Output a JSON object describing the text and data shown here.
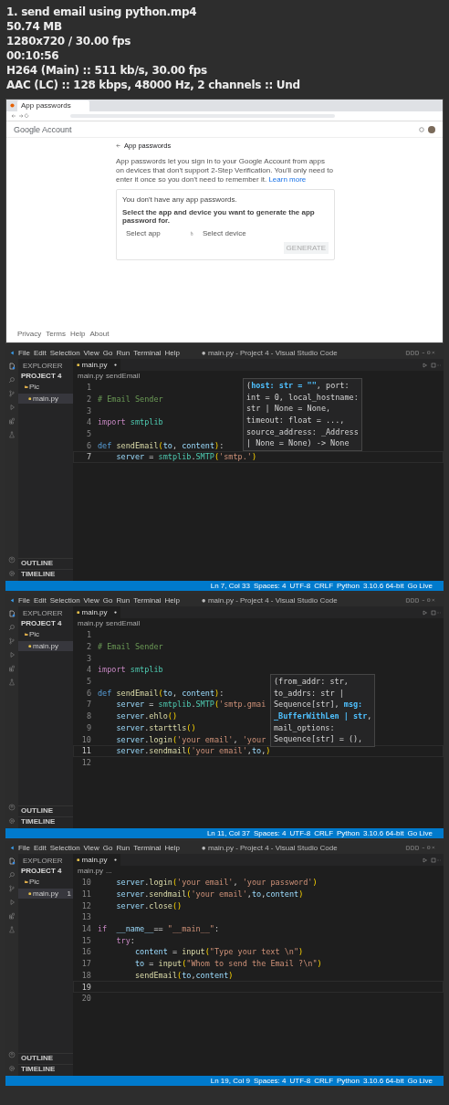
{
  "info_lines": [
    "1. send email using python.mp4",
    "50.74 MB",
    "1280x720 / 30.00 fps",
    "00:10:56",
    "H264 (Main) :: 511 kb/s, 30.00 fps",
    "AAC (LC) :: 128 kbps, 48000 Hz, 2 channels :: Und"
  ],
  "frames": [
    {
      "kind": "browser",
      "tab": "App passwords",
      "brand": "Google Account",
      "heading": "App passwords",
      "intro": "App passwords let you sign in to your Google Account from apps on devices that don't support 2-Step Verification. You'll only need to enter it once so you don't need to remember it.",
      "learn_more": "Learn more",
      "empty_note": "You don't have any app passwords.",
      "instruction": "Select the app and device you want to generate the app password for.",
      "select_app": "Select app",
      "select_device": "Select device",
      "generate": "GENERATE",
      "footer_links": [
        "Privacy",
        "Terms",
        "Help",
        "About"
      ]
    },
    {
      "kind": "editor",
      "menu": [
        "File",
        "Edit",
        "Selection",
        "View",
        "Go",
        "Run",
        "Terminal",
        "Help"
      ],
      "title": "● main.py - Project 4 - Visual Studio Code",
      "explorer": "EXPLORER",
      "project": "PROJECT 4",
      "tree": [
        {
          "label": "Pic",
          "kind": "folder",
          "selected": false
        },
        {
          "label": "main.py",
          "kind": "file",
          "selected": true
        }
      ],
      "tab": "main.py",
      "modified": true,
      "breadcrumb": [
        "main.py",
        "sendEmail"
      ],
      "lines": [
        {
          "number": "1",
          "current": false
        },
        {
          "number": "2",
          "current": false,
          "tokens": [
            {
              "text": "# Email Sender",
              "kind": "cm"
            }
          ]
        },
        {
          "number": "3",
          "current": false
        },
        {
          "number": "4",
          "current": false,
          "tokens": [
            {
              "text": "import",
              "kind": "kw"
            },
            {
              "text": " smtplib",
              "kind": "mod"
            }
          ]
        },
        {
          "number": "5",
          "current": false
        },
        {
          "number": "6",
          "current": false,
          "tokens": [
            {
              "text": "def",
              "kind": "def"
            },
            {
              "text": " sendEmail",
              "kind": "fn"
            },
            {
              "text": "(",
              "kind": "br"
            },
            {
              "text": "to",
              "kind": "var"
            },
            {
              "text": ", ",
              "kind": "p"
            },
            {
              "text": "content",
              "kind": "var"
            },
            {
              "text": ")",
              "kind": "br"
            },
            {
              "text": ":",
              "kind": "p"
            }
          ]
        },
        {
          "number": "7",
          "current": true,
          "tokens": [
            {
              "text": "    server",
              "kind": "var"
            },
            {
              "text": " = ",
              "kind": "p"
            },
            {
              "text": "smtplib",
              "kind": "mod"
            },
            {
              "text": ".",
              "kind": "p"
            },
            {
              "text": "SMTP",
              "kind": "mod"
            },
            {
              "text": "(",
              "kind": "br"
            },
            {
              "text": "'smtp.'",
              "kind": "str"
            },
            {
              "text": ")",
              "kind": "br"
            }
          ]
        }
      ],
      "popup": {
        "lines": [
          [
            {
              "text": "(",
              "kind": "p"
            },
            {
              "text": "host: str = \"\"",
              "kind": "hl"
            },
            {
              "text": ", port:",
              "kind": "p"
            }
          ],
          [
            {
              "text": "int = 0, local_hostname:",
              "kind": "p"
            }
          ],
          [
            {
              "text": "str | None = None,",
              "kind": "p"
            }
          ],
          [
            {
              "text": "timeout: float = ...,",
              "kind": "p"
            }
          ],
          [
            {
              "text": "source_address: _Address",
              "kind": "p"
            }
          ],
          [
            {
              "text": "| None = None) -> None",
              "kind": "p"
            }
          ]
        ]
      },
      "panels": [
        "OUTLINE",
        "TIMELINE"
      ],
      "status": [
        "Ln 7, Col 33",
        "Spaces: 4",
        "UTF-8",
        "CRLF",
        "Python",
        "3.10.6 64-bit",
        "Go Live"
      ]
    },
    {
      "kind": "editor",
      "menu": [
        "File",
        "Edit",
        "Selection",
        "View",
        "Go",
        "Run",
        "Terminal",
        "Help"
      ],
      "title": "● main.py - Project 4 - Visual Studio Code",
      "explorer": "EXPLORER",
      "project": "PROJECT 4",
      "tree": [
        {
          "label": "Pic",
          "kind": "folder",
          "selected": false
        },
        {
          "label": "main.py",
          "kind": "file",
          "selected": true
        }
      ],
      "tab": "main.py",
      "modified": true,
      "breadcrumb": [
        "main.py",
        "sendEmail"
      ],
      "lines": [
        {
          "number": "1",
          "current": false
        },
        {
          "number": "2",
          "current": false,
          "tokens": [
            {
              "text": "# Email Sender",
              "kind": "cm"
            }
          ]
        },
        {
          "number": "3",
          "current": false
        },
        {
          "number": "4",
          "current": false,
          "tokens": [
            {
              "text": "import",
              "kind": "kw"
            },
            {
              "text": " smtplib",
              "kind": "mod"
            }
          ]
        },
        {
          "number": "5",
          "current": false
        },
        {
          "number": "6",
          "current": false,
          "tokens": [
            {
              "text": "def",
              "kind": "def"
            },
            {
              "text": " sendEmail",
              "kind": "fn"
            },
            {
              "text": "(",
              "kind": "br"
            },
            {
              "text": "to",
              "kind": "var"
            },
            {
              "text": ", ",
              "kind": "p"
            },
            {
              "text": "content",
              "kind": "var"
            },
            {
              "text": ")",
              "kind": "br"
            },
            {
              "text": ":",
              "kind": "p"
            }
          ]
        },
        {
          "number": "7",
          "current": false,
          "tokens": [
            {
              "text": "    server",
              "kind": "var"
            },
            {
              "text": " = ",
              "kind": "p"
            },
            {
              "text": "smtplib",
              "kind": "mod"
            },
            {
              "text": ".",
              "kind": "p"
            },
            {
              "text": "SMTP",
              "kind": "mod"
            },
            {
              "text": "(",
              "kind": "br"
            },
            {
              "text": "'smtp.gmai",
              "kind": "str"
            }
          ]
        },
        {
          "number": "8",
          "current": false,
          "tokens": [
            {
              "text": "    server",
              "kind": "var"
            },
            {
              "text": ".",
              "kind": "p"
            },
            {
              "text": "ehlo",
              "kind": "fn"
            },
            {
              "text": "()",
              "kind": "br"
            }
          ]
        },
        {
          "number": "9",
          "current": false,
          "tokens": [
            {
              "text": "    server",
              "kind": "var"
            },
            {
              "text": ".",
              "kind": "p"
            },
            {
              "text": "starttls",
              "kind": "fn"
            },
            {
              "text": "()",
              "kind": "br"
            }
          ]
        },
        {
          "number": "10",
          "current": false,
          "tokens": [
            {
              "text": "    server",
              "kind": "var"
            },
            {
              "text": ".",
              "kind": "p"
            },
            {
              "text": "login",
              "kind": "fn"
            },
            {
              "text": "(",
              "kind": "br"
            },
            {
              "text": "'your email'",
              "kind": "str"
            },
            {
              "text": ", ",
              "kind": "p"
            },
            {
              "text": "'your",
              "kind": "str"
            }
          ]
        },
        {
          "number": "11",
          "current": true,
          "tokens": [
            {
              "text": "    server",
              "kind": "var"
            },
            {
              "text": ".",
              "kind": "p"
            },
            {
              "text": "sendmail",
              "kind": "fn"
            },
            {
              "text": "(",
              "kind": "br"
            },
            {
              "text": "'your email'",
              "kind": "str"
            },
            {
              "text": ",",
              "kind": "p"
            },
            {
              "text": "to",
              "kind": "var"
            },
            {
              "text": ",",
              "kind": "p"
            },
            {
              "text": ")",
              "kind": "br"
            }
          ]
        },
        {
          "number": "12",
          "current": false
        }
      ],
      "popup": {
        "lines": [
          [
            {
              "text": "(from_addr: str,",
              "kind": "p"
            }
          ],
          [
            {
              "text": "to_addrs: str |",
              "kind": "p"
            }
          ],
          [
            {
              "text": "Sequence[str], ",
              "kind": "p"
            },
            {
              "text": "msg:",
              "kind": "hl"
            }
          ],
          [
            {
              "text": "_BufferWithLen | str",
              "kind": "hl"
            },
            {
              "text": ",",
              "kind": "p"
            }
          ],
          [
            {
              "text": "mail_options:",
              "kind": "p"
            }
          ],
          [
            {
              "text": "Sequence[str] = (),",
              "kind": "p"
            }
          ]
        ]
      },
      "panels": [
        "OUTLINE",
        "TIMELINE"
      ],
      "status": [
        "Ln 11, Col 37",
        "Spaces: 4",
        "UTF-8",
        "CRLF",
        "Python",
        "3.10.6 64-bit",
        "Go Live"
      ]
    },
    {
      "kind": "editor",
      "menu": [
        "File",
        "Edit",
        "Selection",
        "View",
        "Go",
        "Run",
        "Terminal",
        "Help"
      ],
      "title": "● main.py - Project 4 - Visual Studio Code",
      "explorer": "EXPLORER",
      "project": "PROJECT 4",
      "tree": [
        {
          "label": "Pic",
          "kind": "folder",
          "selected": false
        },
        {
          "label": "main.py",
          "kind": "file",
          "selected": true,
          "badge": "1"
        }
      ],
      "tab": "main.py",
      "modified": true,
      "breadcrumb": [
        "main.py",
        "..."
      ],
      "lines": [
        {
          "number": "10",
          "current": false,
          "tokens": [
            {
              "text": "    server",
              "kind": "var"
            },
            {
              "text": ".",
              "kind": "p"
            },
            {
              "text": "login",
              "kind": "fn"
            },
            {
              "text": "(",
              "kind": "br"
            },
            {
              "text": "'your email'",
              "kind": "str"
            },
            {
              "text": ", ",
              "kind": "p"
            },
            {
              "text": "'your password'",
              "kind": "str"
            },
            {
              "text": ")",
              "kind": "br"
            }
          ]
        },
        {
          "number": "11",
          "current": false,
          "tokens": [
            {
              "text": "    server",
              "kind": "var"
            },
            {
              "text": ".",
              "kind": "p"
            },
            {
              "text": "sendmail",
              "kind": "fn"
            },
            {
              "text": "(",
              "kind": "br"
            },
            {
              "text": "'your email'",
              "kind": "str"
            },
            {
              "text": ",",
              "kind": "p"
            },
            {
              "text": "to",
              "kind": "var"
            },
            {
              "text": ",",
              "kind": "p"
            },
            {
              "text": "content",
              "kind": "var"
            },
            {
              "text": ")",
              "kind": "br"
            }
          ]
        },
        {
          "number": "12",
          "current": false,
          "tokens": [
            {
              "text": "    server",
              "kind": "var"
            },
            {
              "text": ".",
              "kind": "p"
            },
            {
              "text": "close",
              "kind": "fn"
            },
            {
              "text": "()",
              "kind": "br"
            }
          ]
        },
        {
          "number": "13",
          "current": false
        },
        {
          "number": "14",
          "current": false,
          "tokens": [
            {
              "text": "if",
              "kind": "kw"
            },
            {
              "text": "  __name__",
              "kind": "var"
            },
            {
              "text": "== ",
              "kind": "p"
            },
            {
              "text": "\"__main__\"",
              "kind": "str"
            },
            {
              "text": ":",
              "kind": "p"
            }
          ]
        },
        {
          "number": "15",
          "current": false,
          "tokens": [
            {
              "text": "    try",
              "kind": "kw"
            },
            {
              "text": ":",
              "kind": "p"
            }
          ]
        },
        {
          "number": "16",
          "current": false,
          "tokens": [
            {
              "text": "        content",
              "kind": "var"
            },
            {
              "text": " = ",
              "kind": "p"
            },
            {
              "text": "input",
              "kind": "fn"
            },
            {
              "text": "(",
              "kind": "br"
            },
            {
              "text": "\"Type your text \\n\"",
              "kind": "str"
            },
            {
              "text": ")",
              "kind": "br"
            }
          ]
        },
        {
          "number": "17",
          "current": false,
          "tokens": [
            {
              "text": "        to",
              "kind": "var"
            },
            {
              "text": " = ",
              "kind": "p"
            },
            {
              "text": "input",
              "kind": "fn"
            },
            {
              "text": "(",
              "kind": "br"
            },
            {
              "text": "\"Whom to send the Email ?\\n\"",
              "kind": "str"
            },
            {
              "text": ")",
              "kind": "br"
            }
          ]
        },
        {
          "number": "18",
          "current": false,
          "tokens": [
            {
              "text": "        sendEmail",
              "kind": "fn"
            },
            {
              "text": "(",
              "kind": "br"
            },
            {
              "text": "to",
              "kind": "var"
            },
            {
              "text": ",",
              "kind": "p"
            },
            {
              "text": "content",
              "kind": "var"
            },
            {
              "text": ")",
              "kind": "br"
            }
          ]
        },
        {
          "number": "19",
          "current": true
        },
        {
          "number": "20",
          "current": false
        }
      ],
      "panels": [
        "OUTLINE",
        "TIMELINE"
      ],
      "status": [
        "Ln 19, Col 9",
        "Spaces: 4",
        "UTF-8",
        "CRLF",
        "Python",
        "3.10.6 64-bit",
        "Go Live"
      ]
    }
  ]
}
